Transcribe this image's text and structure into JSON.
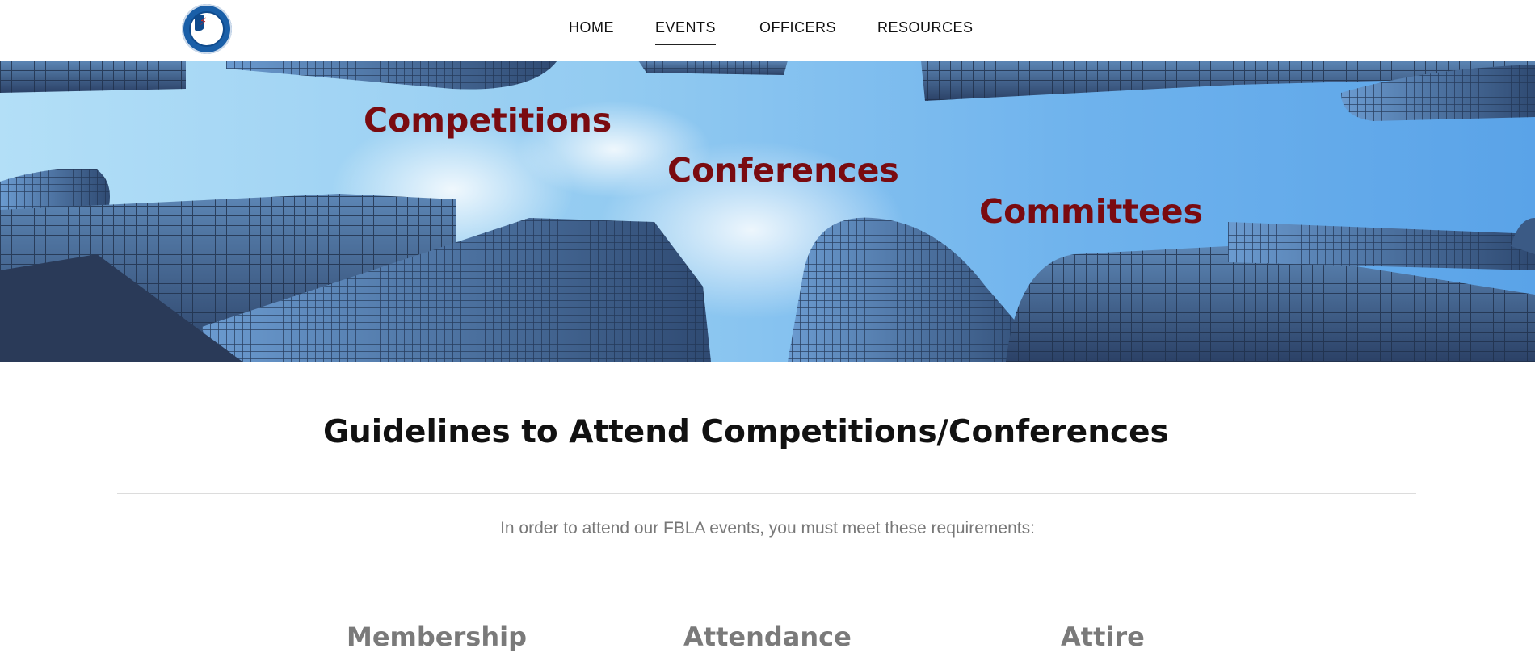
{
  "nav": {
    "items": [
      {
        "label": "HOME"
      },
      {
        "label": "EVENTS"
      },
      {
        "label": "OFFICERS"
      },
      {
        "label": "RESOURCES"
      }
    ],
    "active": "EVENTS"
  },
  "hero": {
    "words": [
      "Competitions",
      "Conferences",
      "Committees"
    ]
  },
  "main": {
    "title": "Guidelines to Attend Competitions/Conferences",
    "intro": "In order to attend our FBLA events, you must meet these requirements:",
    "columns": [
      "Membership",
      "Attendance",
      "Attire"
    ]
  },
  "colors": {
    "hero_text": "#7a0b10",
    "heading": "#111111",
    "subheading": "#7a7a7a",
    "body_text": "#777777",
    "logo_blue": "#1a5fa8"
  },
  "icons": {
    "logo": "illinois-fbla-seal-icon"
  }
}
